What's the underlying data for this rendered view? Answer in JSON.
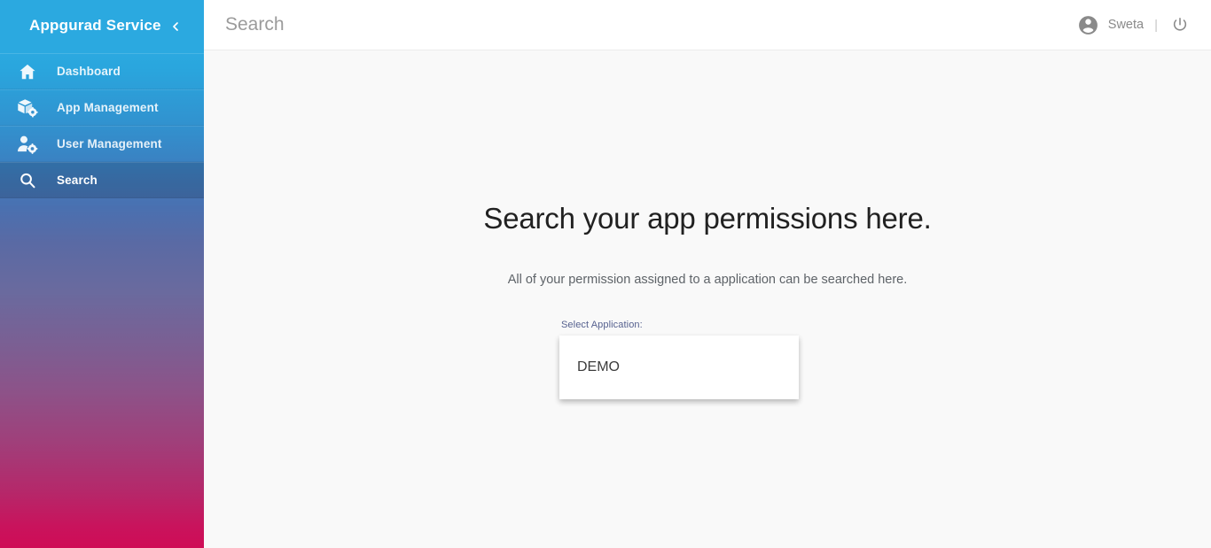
{
  "sidebar": {
    "brand": "Appgurad Service",
    "collapse_icon": "chevron-left-icon",
    "header_color": "#29abe2",
    "gradient_start": "#2ba9e0",
    "gradient_end": "#cf0c56",
    "items": [
      {
        "label": "Dashboard",
        "icon": "home-icon",
        "active": false
      },
      {
        "label": "App Management",
        "icon": "box-gear-icon",
        "active": false
      },
      {
        "label": "User Management",
        "icon": "user-gear-icon",
        "active": false
      },
      {
        "label": "Search",
        "icon": "magnifier-icon",
        "active": true
      }
    ]
  },
  "topbar": {
    "search_placeholder": "Search",
    "search_value": "",
    "account_icon": "account-circle-icon",
    "user_name": "Sweta",
    "divider": "|",
    "power_icon": "power-icon"
  },
  "content": {
    "title": "Search your app permissions here.",
    "subtitle": "All of your permission assigned to a application can be searched here.",
    "select_label": "Select Application:",
    "label_color": "#56618f",
    "dropdown": {
      "options": [
        "DEMO"
      ],
      "selected": "DEMO"
    }
  }
}
